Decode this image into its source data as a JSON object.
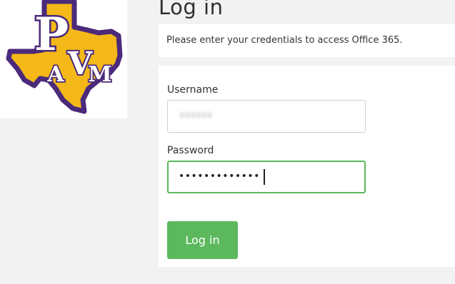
{
  "logo": {
    "icon": "pvamu-texas-logo",
    "letters": "PVAM",
    "colors": {
      "purple": "#4b2a7a",
      "gold": "#f4b818"
    }
  },
  "page": {
    "title": "Log in"
  },
  "notice": {
    "text": "Please enter your credentials to access Office 365."
  },
  "form": {
    "username_label": "Username",
    "username_value": "xxxxxx",
    "password_label": "Password",
    "password_value": "•••••••••••••",
    "submit_label": "Log in"
  },
  "colors": {
    "accent": "#5cb85c",
    "background": "#f2f2f2"
  }
}
